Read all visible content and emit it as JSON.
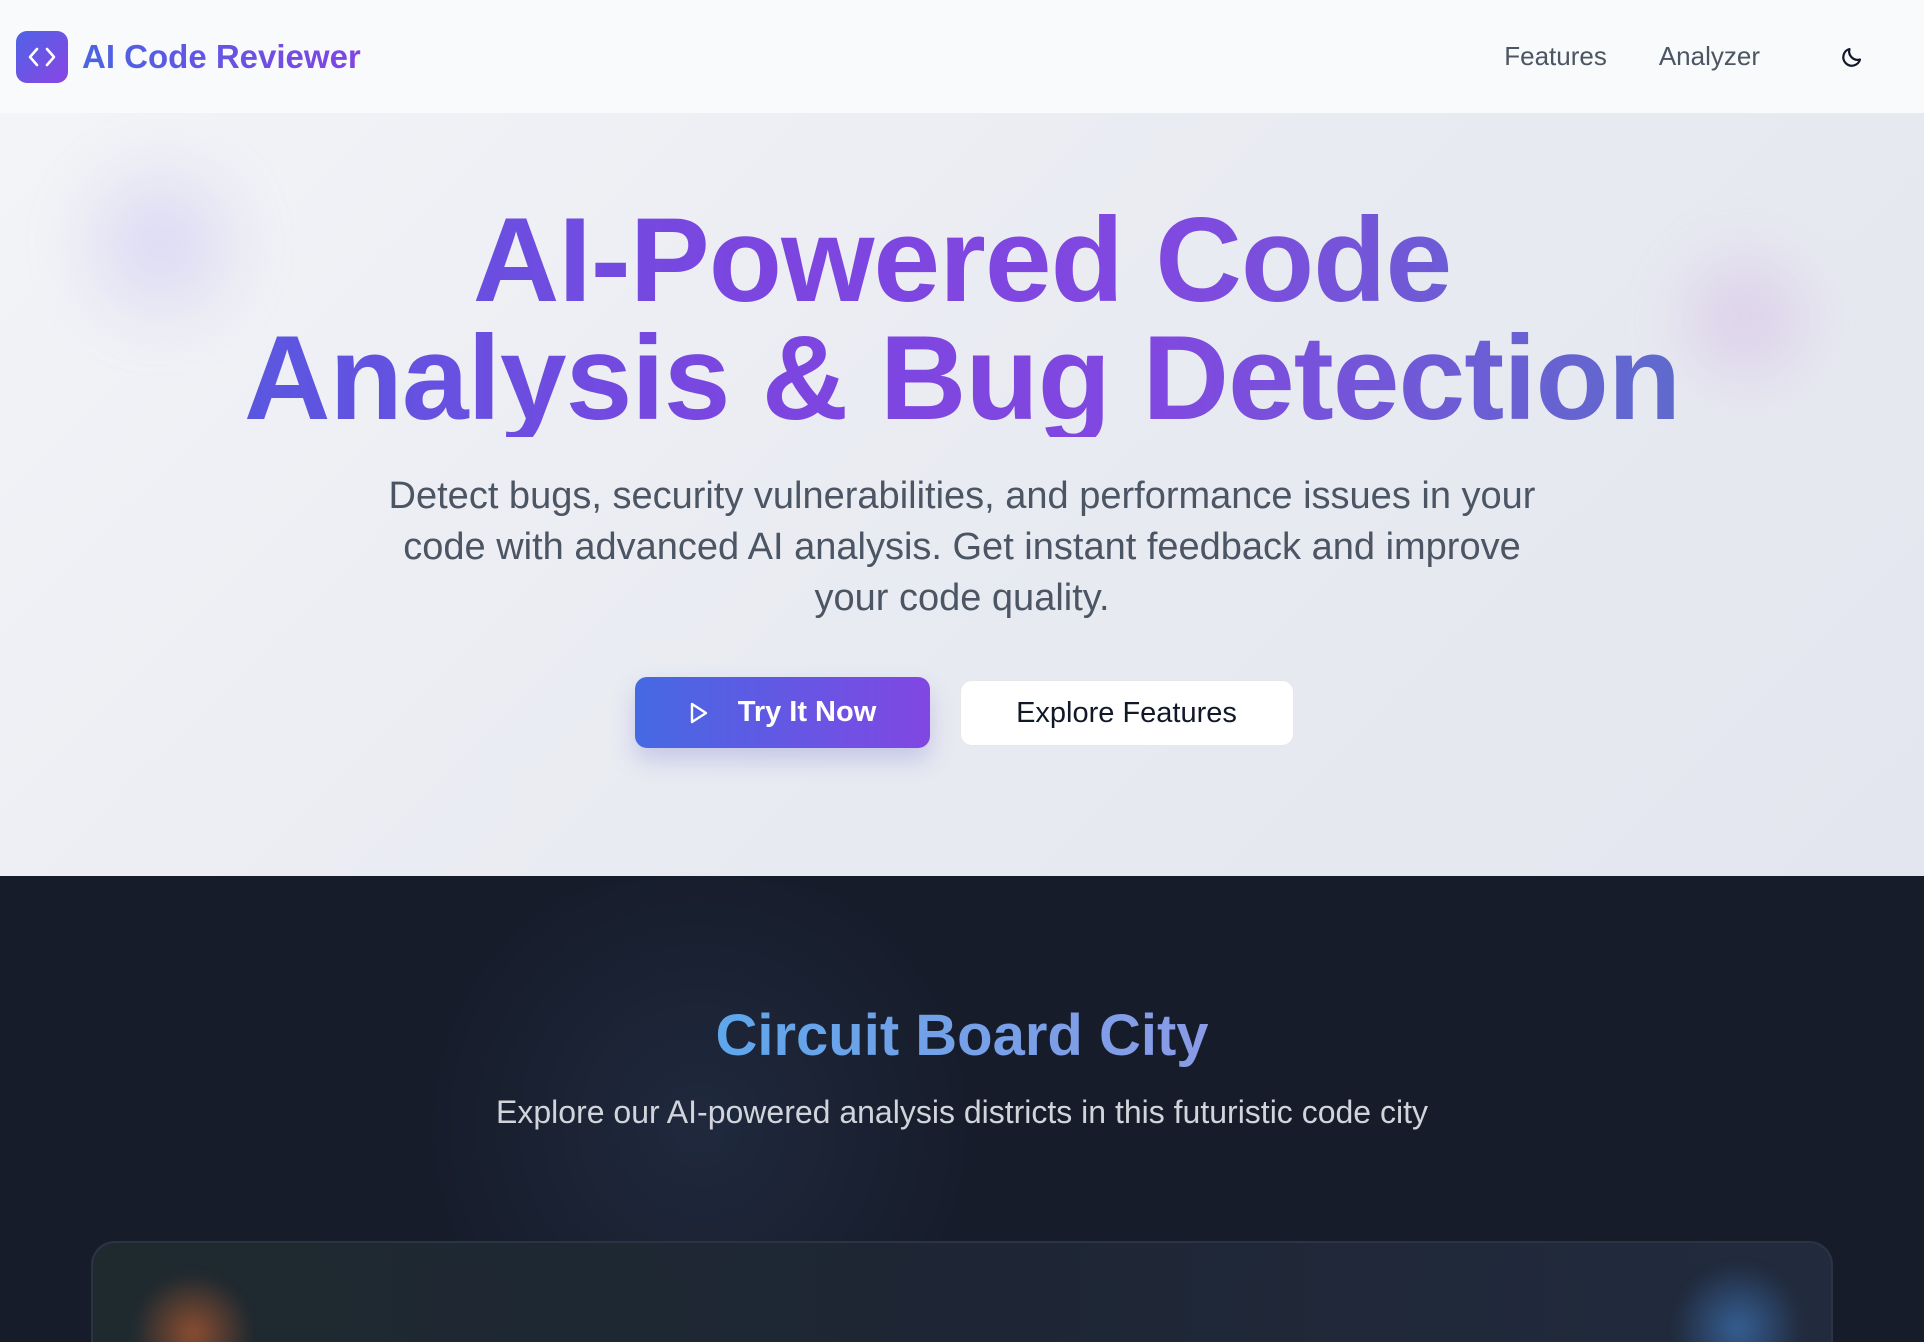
{
  "header": {
    "brand_name": "AI Code Reviewer",
    "nav": [
      {
        "label": "Features"
      },
      {
        "label": "Analyzer"
      }
    ]
  },
  "hero": {
    "title_line1": "AI-Powered Code",
    "title_line2": "Analysis & Bug Detection",
    "subtitle": "Detect bugs, security vulnerabilities, and performance issues in your code with advanced AI analysis. Get instant feedback and improve your code quality.",
    "primary_button": "Try It Now",
    "secondary_button": "Explore Features"
  },
  "city": {
    "title": "Circuit Board City",
    "subtitle": "Explore our AI-powered analysis districts in this futuristic code city"
  },
  "icons": {
    "brand": "code-brackets-icon",
    "theme": "moon-icon",
    "play": "play-icon"
  },
  "colors": {
    "accent_blue": "#4a64e2",
    "accent_purple": "#8244e4",
    "dark_section": "#161c2a"
  }
}
